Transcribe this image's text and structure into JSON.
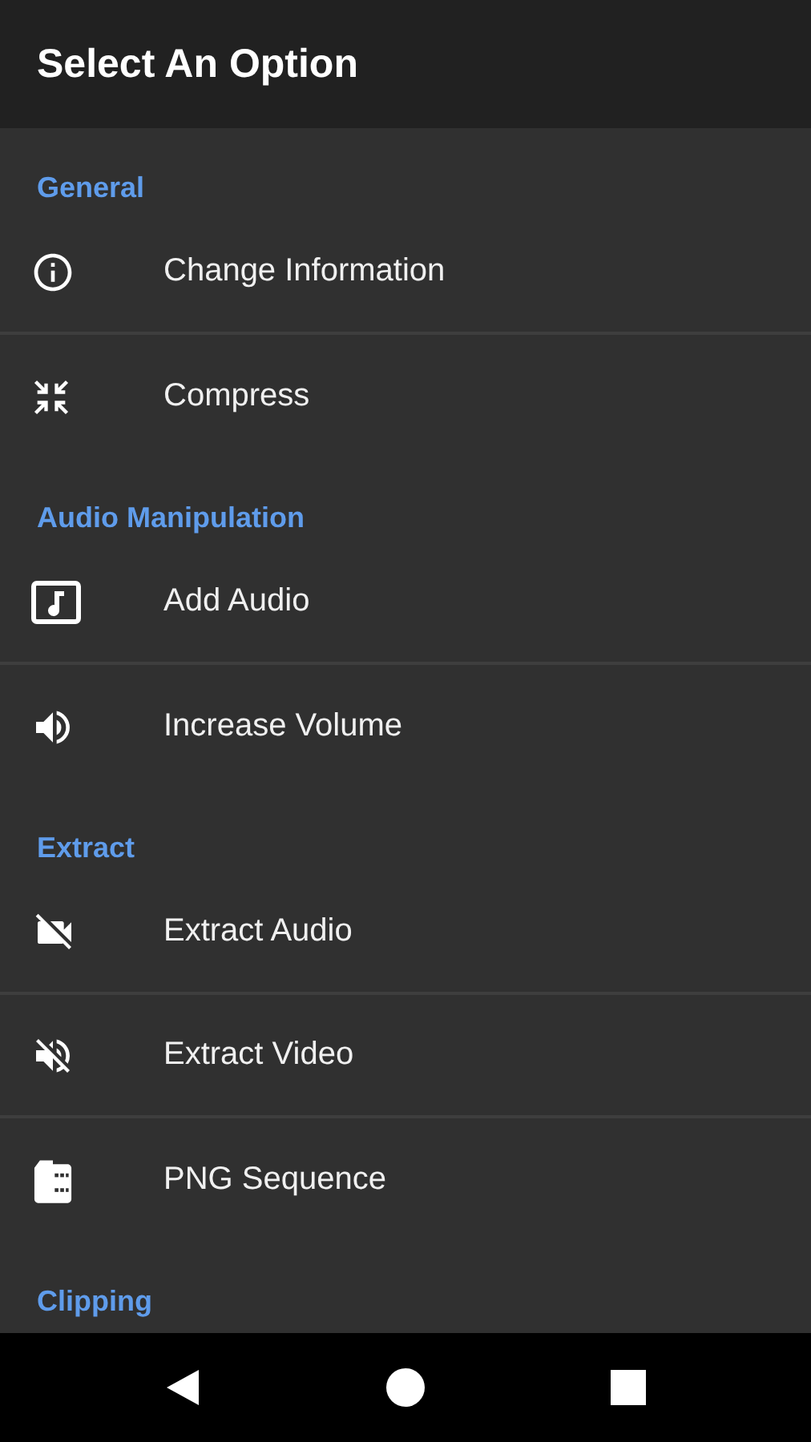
{
  "app_bar": {
    "title": "Select An Option"
  },
  "sections": [
    {
      "title": "General",
      "items": [
        {
          "label": "Change Information"
        },
        {
          "label": "Compress"
        }
      ]
    },
    {
      "title": "Audio Manipulation",
      "items": [
        {
          "label": "Add Audio"
        },
        {
          "label": "Increase Volume"
        }
      ]
    },
    {
      "title": "Extract",
      "items": [
        {
          "label": "Extract Audio"
        },
        {
          "label": "Extract Video"
        },
        {
          "label": "PNG Sequence"
        }
      ]
    },
    {
      "title": "Clipping"
    }
  ]
}
